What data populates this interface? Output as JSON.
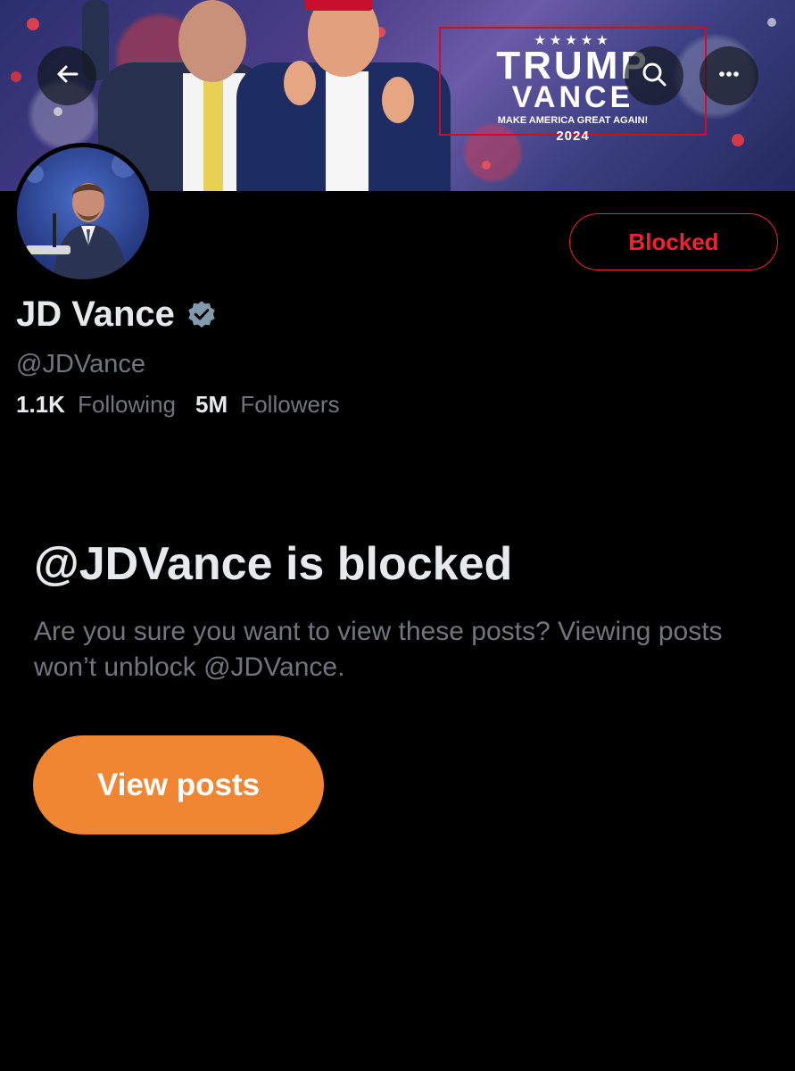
{
  "banner": {
    "logo": {
      "stars": "★★★★★",
      "line1": "TRUMP",
      "line2": "VANCE",
      "line3": "MAKE AMERICA GREAT AGAIN!",
      "line4": "2024"
    }
  },
  "nav": {
    "back_icon": "arrow-left-icon",
    "search_icon": "search-icon",
    "more_icon": "more-horizontal-icon"
  },
  "profile": {
    "name": "JD Vance",
    "handle": "@JDVance",
    "following_count": "1.1K",
    "following_label": "Following",
    "followers_count": "5M",
    "followers_label": "Followers",
    "blocked_label": "Blocked"
  },
  "blocked_notice": {
    "title": "@JDVance is blocked",
    "description": "Are you sure you want to view these posts? Viewing posts won’t unblock @JDVance.",
    "button_label": "View posts"
  },
  "colors": {
    "background": "#000000",
    "primary_text": "#e7e9ea",
    "secondary_text": "#71767b",
    "blocked_red": "#f4212e",
    "view_button": "#f08532",
    "verified_badge": "#829aab"
  }
}
